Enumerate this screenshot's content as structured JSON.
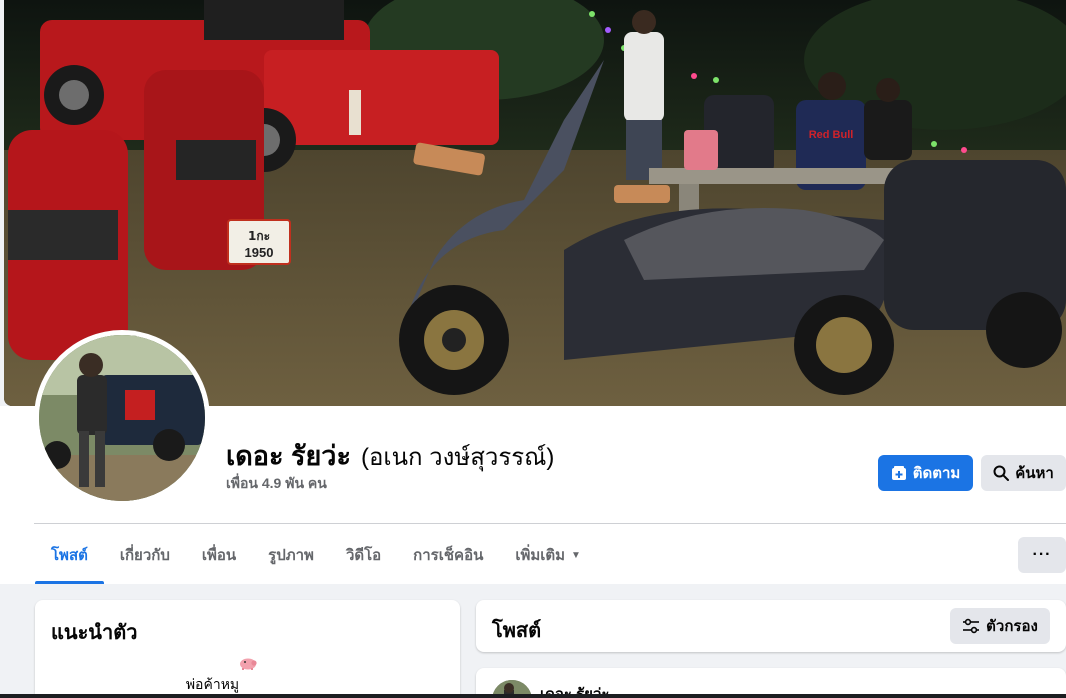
{
  "profile": {
    "name": "เดอะ รัยว่ะ",
    "alternate_name": "(อเนก วงษ์สุวรรณ์)",
    "friends_text": "เพื่อน 4.9 พัน คน"
  },
  "cover": {
    "plate_line1": "1กะ",
    "plate_line2": "1950",
    "shirt_brand": "Red Bull"
  },
  "actions": {
    "follow_label": "ติดตาม",
    "search_label": "ค้นหา",
    "more_label": "···"
  },
  "tabs": [
    {
      "label": "โพสต์",
      "active": true
    },
    {
      "label": "เกี่ยวกับ",
      "active": false
    },
    {
      "label": "เพื่อน",
      "active": false
    },
    {
      "label": "รูปภาพ",
      "active": false
    },
    {
      "label": "วิดีโอ",
      "active": false
    },
    {
      "label": "การเช็คอิน",
      "active": false
    },
    {
      "label": "เพิ่มเติม",
      "active": false
    }
  ],
  "intro": {
    "title": "แนะนำตัว",
    "emoji": "🐖",
    "bio": "พ่อค้าหมู"
  },
  "posts": {
    "title": "โพสต์",
    "filter_label": "ตัวกรอง",
    "first_author": "เดอะ รัยว่ะ"
  },
  "colors": {
    "accent": "#1b74e4",
    "page_bg": "#f0f2f5",
    "secondary_btn": "#e4e6eb",
    "muted_text": "#65676b"
  }
}
